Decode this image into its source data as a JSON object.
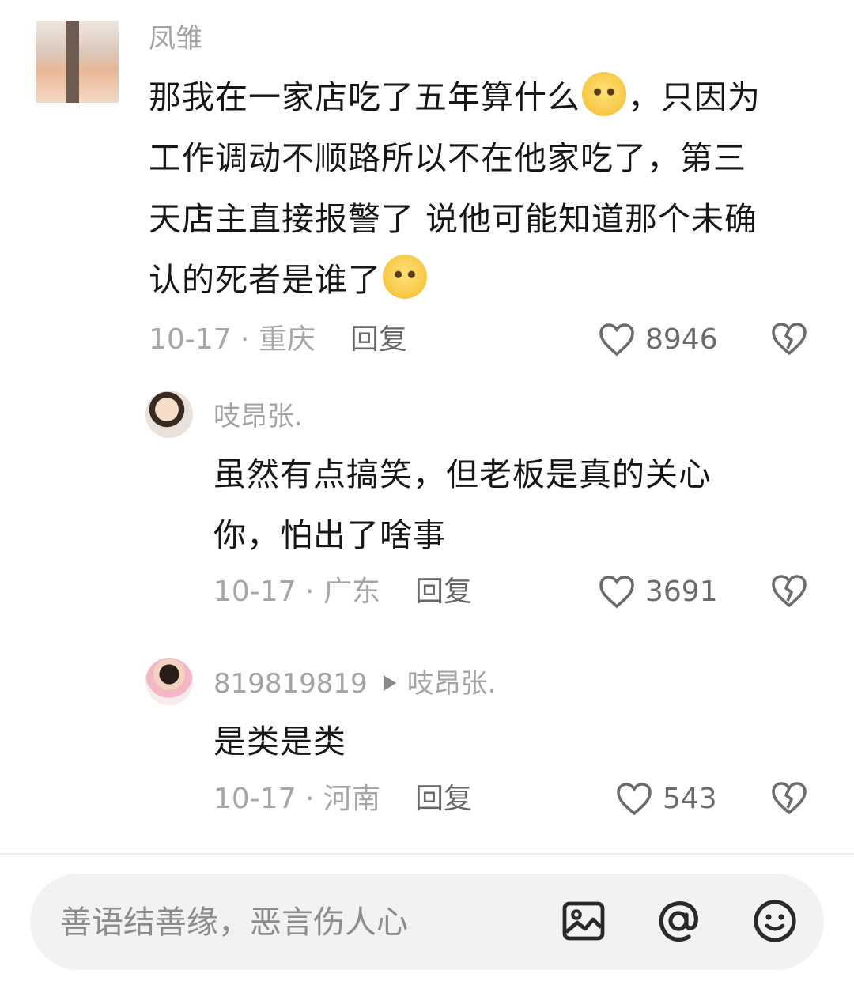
{
  "comments": [
    {
      "username": "凤雏",
      "lines": [
        "那我在一家店吃了五年算什么",
        "，只因为",
        "工作调动不顺路所以不在他家吃了，第三",
        "天店主直接报警了 说他可能知道那个未确",
        "认的死者是谁了"
      ],
      "date": "10-17 · 重庆",
      "reply_label": "回复",
      "likes": "8946"
    },
    {
      "username": "吱昂张.",
      "lines": [
        "虽然有点搞笑，但老板是真的关心",
        "你，怕出了啥事"
      ],
      "date": "10-17 · 广东",
      "reply_label": "回复",
      "likes": "3691"
    },
    {
      "username": "819819819",
      "reply_to": "吱昂张.",
      "lines": [
        "是类是类"
      ],
      "date": "10-17 · 河南",
      "reply_label": "回复",
      "likes": "543"
    }
  ],
  "input": {
    "placeholder": "善语结善缘，恶言伤人心",
    "icons": [
      "image-icon",
      "mention-icon",
      "emoji-icon"
    ]
  },
  "colors": {
    "username": "#a3a3a3",
    "text": "#161616",
    "meta": "#a6a6a6",
    "input_bg": "#f2f2f2",
    "emoji": "#f7cb3f"
  }
}
